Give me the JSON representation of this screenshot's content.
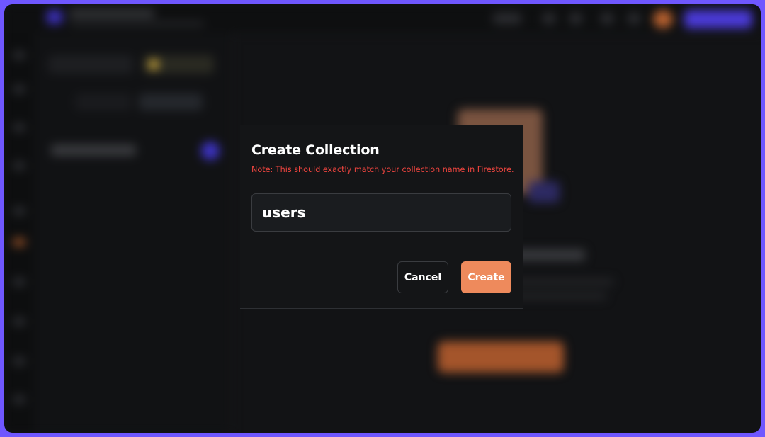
{
  "colors": {
    "frame_border": "#6f57ff",
    "background": "#121315",
    "modal_background": "#141517",
    "note_text": "#f0453f",
    "create_button": "#ee8a5c"
  },
  "modal": {
    "title": "Create Collection",
    "note": "Note: This should exactly match your collection name in Firestore.",
    "input": {
      "value": "users"
    },
    "cancel_label": "Cancel",
    "create_label": "Create"
  }
}
